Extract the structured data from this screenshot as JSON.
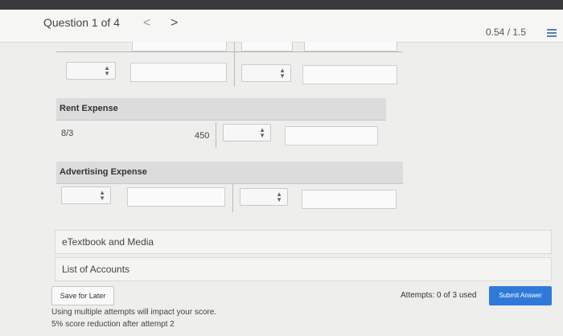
{
  "header": {
    "question_label": "Question 1 of 4",
    "prev_glyph": "<",
    "next_glyph": ">",
    "score": "0.54 / 1.5"
  },
  "accounts": [
    {
      "name": "Rent Expense",
      "rows": [
        {
          "date": "8/3",
          "amount": "450"
        }
      ]
    },
    {
      "name": "Advertising Expense",
      "rows": []
    }
  ],
  "links": {
    "etextbook": "eTextbook and Media",
    "accounts_list": "List of Accounts"
  },
  "footer": {
    "save_label": "Save for Later",
    "attempts": "Attempts: 0 of 3 used",
    "submit_label": "Submit Answer",
    "note_1": "Using multiple attempts will impact your score.",
    "note_2": "5% score reduction after attempt 2"
  }
}
